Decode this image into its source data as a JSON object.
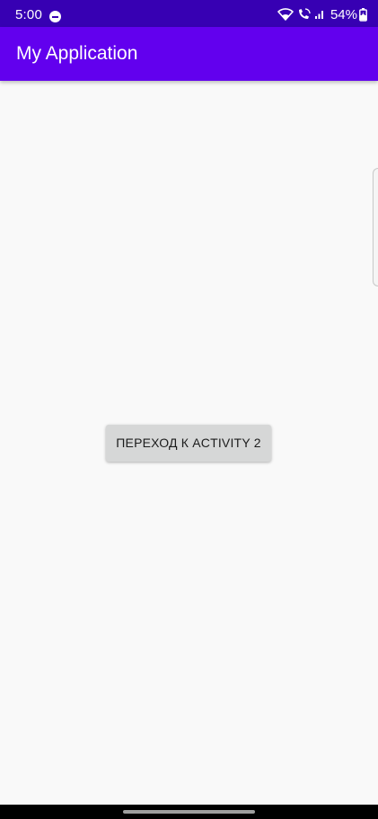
{
  "status_bar": {
    "time": "5:00",
    "battery": "54%",
    "icons": [
      "do-not-disturb-icon",
      "wifi-icon",
      "wifi-calling-icon",
      "signal-icon",
      "battery-charging-icon"
    ]
  },
  "app_bar": {
    "title": "My Application"
  },
  "main": {
    "button_label": "ПЕРЕХОД К ACTIVITY 2"
  },
  "colors": {
    "status_bar": "#3700b3",
    "app_bar": "#6200ee",
    "background": "#f9f9f9",
    "button": "#d6d7d7"
  }
}
